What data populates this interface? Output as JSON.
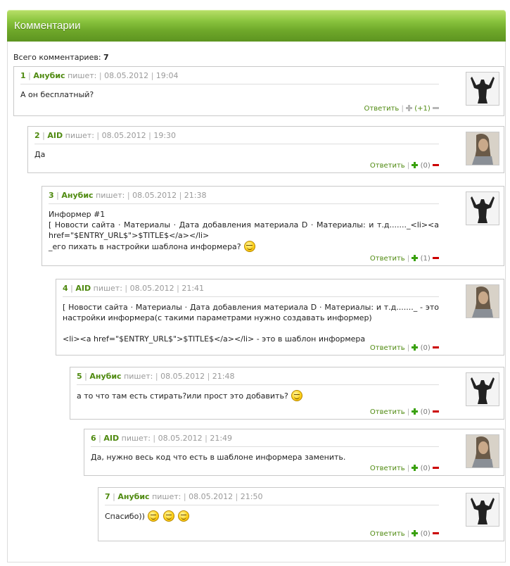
{
  "header": {
    "title": "Комментарии"
  },
  "summary": {
    "label": "Всего комментариев:",
    "count": "7"
  },
  "labels": {
    "writes": "пишет:",
    "reply": "Ответить",
    "separator": "|"
  },
  "colors": {
    "accent_green": "#4f8a10",
    "header_green": "#6fa82a",
    "minus_red": "#cc0000"
  },
  "comments": [
    {
      "num": "1",
      "author": "Анубис",
      "date": "08.05.2012",
      "time": "19:04",
      "lines": [
        "А он бесплатный?"
      ],
      "rating": "(+1)",
      "avatar": "anubis-avatar-icon"
    },
    {
      "num": "2",
      "author": "AID",
      "date": "08.05.2012",
      "time": "19:30",
      "lines": [
        "Да"
      ],
      "rating": "(0)",
      "avatar": "aid-avatar-icon"
    },
    {
      "num": "3",
      "author": "Анубис",
      "date": "08.05.2012",
      "time": "21:38",
      "lines": [
        "Информер #1",
        "[ Новости сайта · Материалы · Дата добавления материала D · Материалы: и т.д......._<li><a href=\"$ENTRY_URL$\">$TITLE$</a></li>",
        "_его пихать в настройки шаблона информера?"
      ],
      "rating": "(1)",
      "avatar": "anubis-avatar-icon"
    },
    {
      "num": "4",
      "author": "AID",
      "date": "08.05.2012",
      "time": "21:41",
      "lines": [
        "[ Новости сайта · Материалы · Дата добавления материала D · Материалы: и т.д......._ - это настройки информера(с такими параметрами нужно создавать информер)",
        "",
        "<li><a href=\"$ENTRY_URL$\">$TITLE$</a></li> - это в шаблон информера"
      ],
      "rating": "(0)",
      "avatar": "aid-avatar-icon"
    },
    {
      "num": "5",
      "author": "Анубис",
      "date": "08.05.2012",
      "time": "21:48",
      "lines": [
        "а то что там есть стирать?или прост это добавить?"
      ],
      "rating": "(0)",
      "avatar": "anubis-avatar-icon"
    },
    {
      "num": "6",
      "author": "AID",
      "date": "08.05.2012",
      "time": "21:49",
      "lines": [
        "Да, нужно весь код что есть в шаблоне информера заменить."
      ],
      "rating": "(0)",
      "avatar": "aid-avatar-icon"
    },
    {
      "num": "7",
      "author": "Анубис",
      "date": "08.05.2012",
      "time": "21:50",
      "lines": [
        "Спасибо))"
      ],
      "rating": "(0)",
      "avatar": "anubis-avatar-icon"
    }
  ]
}
